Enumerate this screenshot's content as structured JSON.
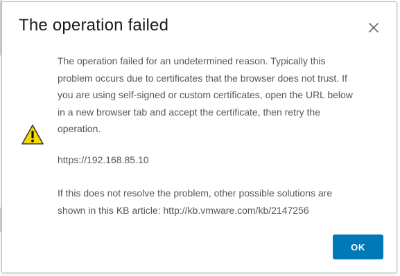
{
  "dialog": {
    "title": "The operation failed",
    "icons": {
      "close": "close-icon",
      "warning": "warning-icon"
    },
    "message": "The operation failed for an undetermined reason. Typically this problem occurs due to certificates that the browser does not trust. If you are using self-signed or custom certificates, open the URL below in a new browser tab and accept the certificate, then retry the operation.",
    "url": "https://192.168.85.10",
    "kb_text": "If this does not resolve the problem, other possible solutions are shown in this KB article: http://kb.vmware.com/kb/2147256",
    "ok_label": "OK"
  },
  "colors": {
    "primary_button": "#0079b8",
    "warning_fill": "#f5d800",
    "body_text": "#565656",
    "title_text": "#1a1a1a"
  }
}
